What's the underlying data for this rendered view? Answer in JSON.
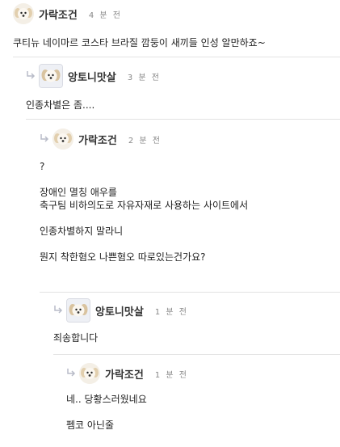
{
  "comments": [
    {
      "nick": "가락조건",
      "time": "4 분 전",
      "lines": [
        "쿠티뉴 네이마르 코스타 브라질 깜둥이 새끼들 인성 알만하죠~"
      ]
    },
    {
      "nick": "앙토니맛살",
      "time": "3 분 전",
      "lines": [
        "인종차별은 좀...."
      ]
    },
    {
      "nick": "가락조건",
      "time": "2 분 전",
      "lines": [
        "?",
        "",
        "장애인 멸칭 애우를",
        "축구팀 비하의도로 자유자재로 사용하는 사이트에서",
        "",
        "인종차별하지 말라니",
        "",
        "뭔지 착한혐오 나쁜혐오 따로있는건가요?"
      ]
    },
    {
      "nick": "앙토니맛살",
      "time": "1 분 전",
      "lines": [
        "죄송합니다"
      ]
    },
    {
      "nick": "가락조건",
      "time": "1 분 전",
      "lines": [
        "네.. 당황스러웠네요",
        "",
        "펨코 아닌줄"
      ]
    }
  ],
  "icons": {
    "reply": "reply-arrow-icon",
    "avatar_a": "puppy-avatar-icon",
    "avatar_b": "puppy-avatar-icon"
  }
}
